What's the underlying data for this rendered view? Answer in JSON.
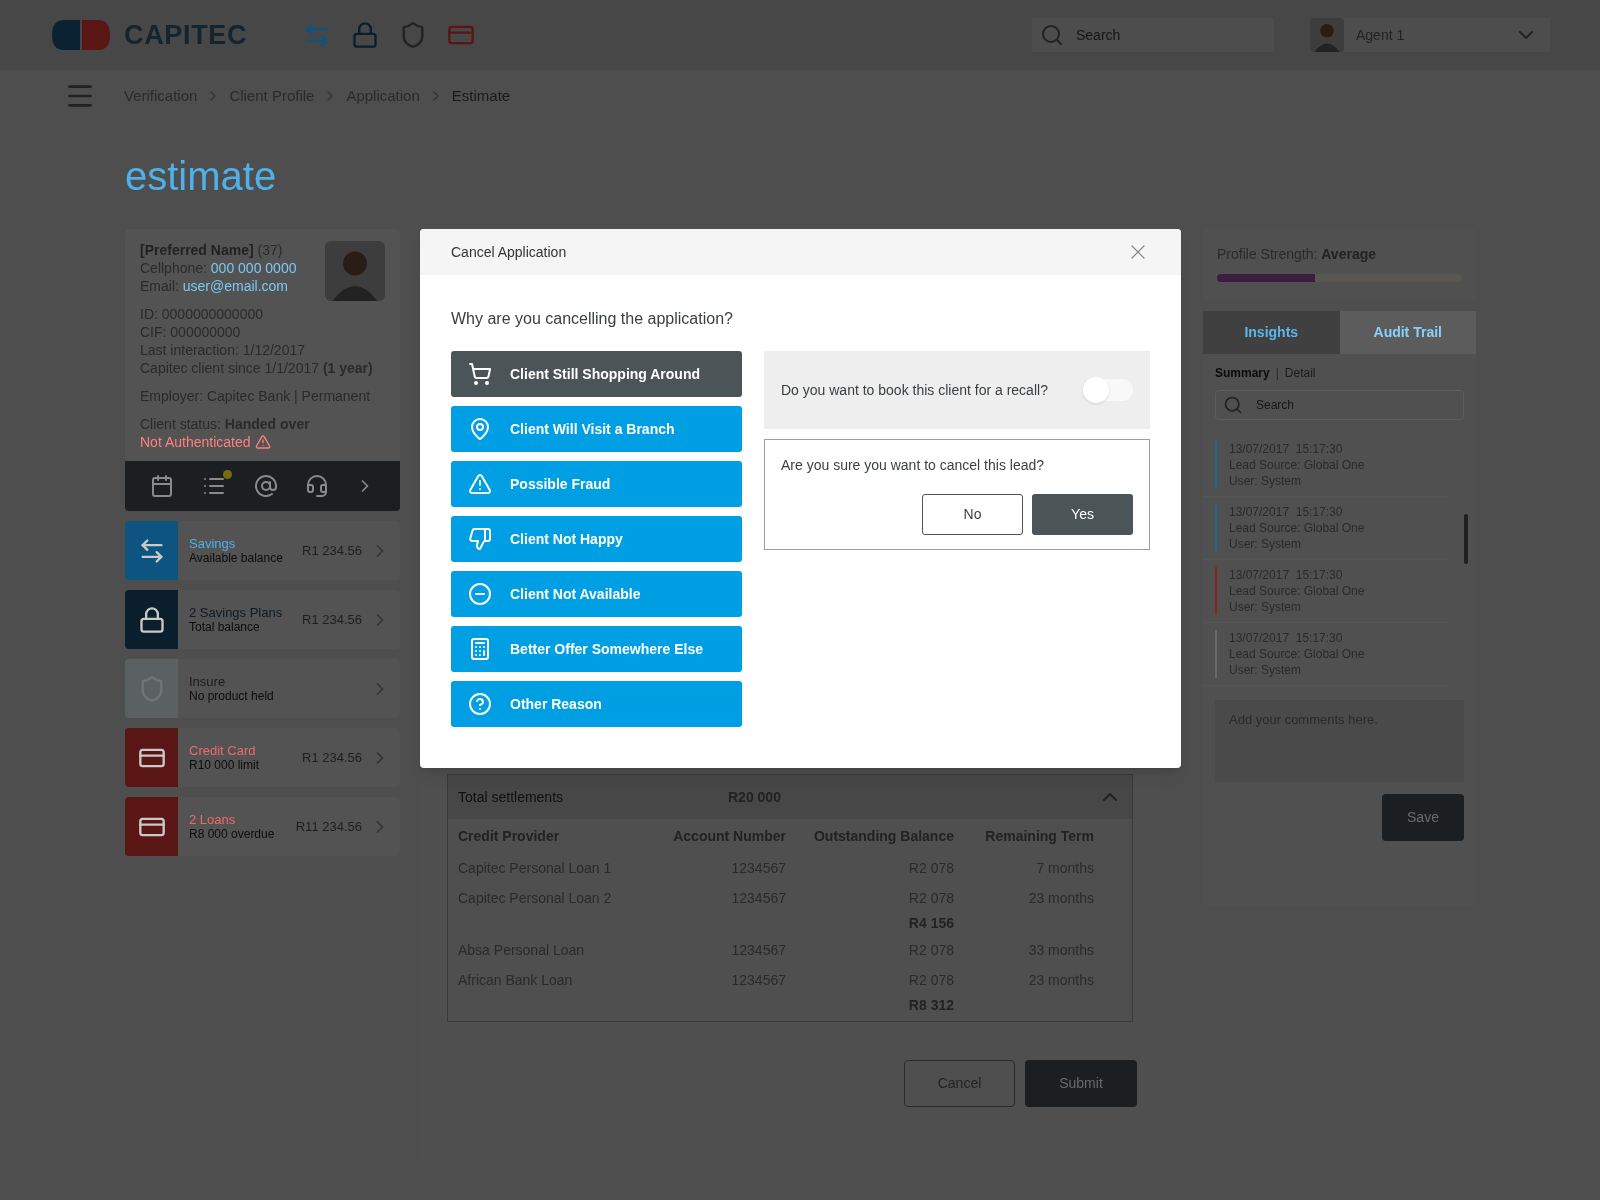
{
  "header": {
    "logo_text": "CAPITEC",
    "search": {
      "placeholder": "Search"
    },
    "user": "Agent 1"
  },
  "breadcrumb": [
    "Verification",
    "Client Profile",
    "Application",
    "Estimate"
  ],
  "page_title": "estimate",
  "client": {
    "name": "[Preferred Name]",
    "age": "(37)",
    "cellphone_label": "Cellphone:",
    "cellphone": "000 000 0000",
    "email_label": "Email:",
    "email": "user@email.com",
    "details": [
      "ID: 0000000000000",
      "CIF: 000000000",
      "Last interaction: 1/12/2017",
      "Capitec client since 1/1/2017 **(1 year)**"
    ],
    "employer": "Employer: Capitec Bank | Permanent",
    "status": "Client status: **Handed over**",
    "auth": "Not Authenticated"
  },
  "products": [
    {
      "kind": "savings",
      "title": "Savings",
      "subtitle": "Available balance",
      "amount": "R1 234.56"
    },
    {
      "kind": "plans",
      "title": "2 Savings Plans",
      "subtitle": "Total balance",
      "amount": "R1 234.56"
    },
    {
      "kind": "insure",
      "title": "Insure",
      "subtitle": "No product held"
    },
    {
      "kind": "credit",
      "title": "Credit Card",
      "subtitle": "R10 000 limit",
      "amount": "R1 234.56"
    },
    {
      "kind": "loans",
      "title": "2 Loans",
      "subtitle": "R8 000 overdue",
      "amount": "R11 234.56"
    }
  ],
  "settlements": {
    "total_label": "Total settlements",
    "total": "R20 000",
    "expanded": true,
    "columns": [
      "Credit Provider",
      "Account Number",
      "Outstanding Balance",
      "Remaining Term"
    ],
    "rows": [
      {
        "kind": "loan",
        "provider": "Capitec Personal Loan 1",
        "account": "1234567",
        "balance": "R2 078",
        "term": "7 months"
      },
      {
        "kind": "loan",
        "provider": "Capitec Personal Loan 2",
        "account": "1234567",
        "balance": "R2 078",
        "term": "23 months"
      },
      {
        "kind": "subtotal",
        "balance": "R4 156"
      },
      {
        "kind": "loan",
        "provider": "Absa Personal Loan",
        "account": "1234567",
        "balance": "R2 078",
        "term": "33 months"
      },
      {
        "kind": "loan",
        "provider": "African Bank Loan",
        "account": "1234567",
        "balance": "R2 078",
        "term": "23 months"
      },
      {
        "kind": "subtotal",
        "balance": "R8 312"
      }
    ]
  },
  "actions": {
    "cancel": "Cancel",
    "submit": "Submit"
  },
  "profile_strength": {
    "label": "Profile Strength:",
    "value": "Average",
    "level": 0.4
  },
  "tabs": [
    {
      "label": "Insights",
      "selected": false
    },
    {
      "label": "Audit Trail",
      "selected": true
    }
  ],
  "subtabs": [
    {
      "label": "Summary",
      "selected": true
    },
    {
      "label": "Detail",
      "selected": false
    }
  ],
  "subtab_separator": "|",
  "audit_search": {
    "placeholder": "Search"
  },
  "audit_entries": [
    {
      "date": "13/07/2017",
      "time": "15:17:30",
      "source": "Lead Source: Global One",
      "user": "User: System",
      "color": "#1a6a94"
    },
    {
      "date": "13/07/2017",
      "time": "15:17:30",
      "source": "Lead Source: Global One",
      "user": "User: System",
      "color": "#1a6a94"
    },
    {
      "date": "13/07/2017",
      "time": "15:17:30",
      "source": "Lead Source: Global One",
      "user": "User: System",
      "color": "#8a2222"
    },
    {
      "date": "13/07/2017",
      "time": "15:17:30",
      "source": "Lead Source: Global One",
      "user": "User: System",
      "color": "#6a6a6a"
    }
  ],
  "comments": {
    "placeholder": "Add your comments here."
  },
  "save": "Save",
  "modal": {
    "title": "Cancel Application",
    "question": "Why are you cancelling the application?",
    "reasons": [
      {
        "kind": "cart",
        "label": "Client Still Shopping Around",
        "selected": true
      },
      {
        "kind": "pin",
        "label": "Client Will Visit a Branch",
        "selected": false
      },
      {
        "kind": "warning",
        "label": "Possible Fraud",
        "selected": false
      },
      {
        "kind": "thumbs-down",
        "label": "Client Not Happy",
        "selected": false
      },
      {
        "kind": "unavailable",
        "label": "Client Not Available",
        "selected": false
      },
      {
        "kind": "calculator",
        "label": "Better Offer Somewhere Else",
        "selected": false
      },
      {
        "kind": "question",
        "label": "Other Reason",
        "selected": false
      }
    ],
    "recall_question": "Do you want to book this client for a recall?",
    "recall_on": false,
    "confirm_question": "Are you sure you want to cancel this lead?",
    "no": "No",
    "yes": "Yes"
  }
}
